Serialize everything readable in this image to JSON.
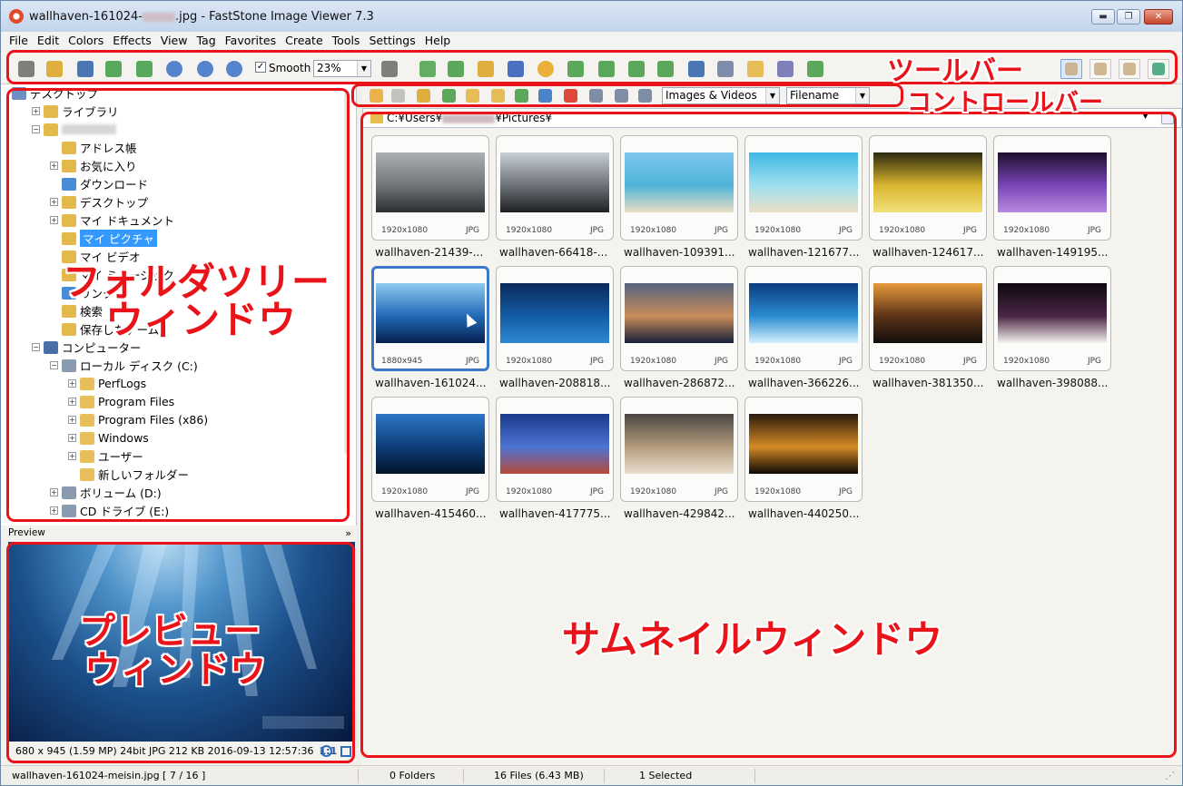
{
  "window": {
    "title_prefix": "wallhaven-161024-",
    "title_suffix": ".jpg  -  FastStone Image Viewer 7.3",
    "min_glyph": "▬",
    "max_glyph": "❐",
    "close_glyph": "✕"
  },
  "menu": [
    "File",
    "Edit",
    "Colors",
    "Effects",
    "View",
    "Tag",
    "Favorites",
    "Create",
    "Tools",
    "Settings",
    "Help"
  ],
  "toolbar": {
    "smooth_label": "Smooth",
    "smooth_checked": "✓",
    "zoom_value": "23%",
    "dropdown_glyph": "▼",
    "icons": [
      "camera-icon",
      "open-folder-icon",
      "save-icon",
      "previous-icon",
      "next-icon",
      "zoom-in-icon",
      "zoom-out-icon",
      "actual-size-icon",
      "hand-tool-icon",
      "slideshow-icon",
      "resize-icon",
      "crop-icon",
      "color-adjust-icon",
      "brightness-icon",
      "stamp-icon",
      "rotate-left-icon",
      "rotate-right-icon",
      "compare-icon",
      "screen-capture-icon",
      "scanner-icon",
      "email-icon",
      "print-icon",
      "batch-icon"
    ],
    "view_icons": [
      "thumbnails-view-icon",
      "preview-view-icon",
      "browser-view-icon",
      "fullscreen-icon"
    ]
  },
  "control_bar": {
    "icons": [
      "back-arrow-icon",
      "forward-arrow-icon",
      "up-folder-icon",
      "refresh-icon",
      "favorites-icon",
      "new-folder-icon",
      "copy-to-icon",
      "move-to-icon",
      "delete-icon",
      "thumbnail-size-icon",
      "details-view-icon",
      "list-view-icon"
    ],
    "filter": "Images & Videos",
    "sort": "Filename"
  },
  "path": {
    "prefix": "C:¥Users¥",
    "suffix": "¥Pictures¥"
  },
  "tree": [
    {
      "label": "デスクトップ",
      "indent": 0,
      "expander": "",
      "icon": "desktop-icon",
      "color": "#6d8fc4"
    },
    {
      "label": "ライブラリ",
      "indent": 1,
      "expander": "+",
      "icon": "library-icon",
      "color": "#e2b94a"
    },
    {
      "label": "",
      "indent": 1,
      "expander": "−",
      "icon": "user-folder-icon",
      "color": "#e2b94a"
    },
    {
      "label": "アドレス帳",
      "indent": 2,
      "expander": "",
      "icon": "contacts-icon",
      "color": "#e2b94a"
    },
    {
      "label": "お気に入り",
      "indent": 2,
      "expander": "+",
      "icon": "favorites-folder-icon",
      "color": "#e2b94a"
    },
    {
      "label": "ダウンロード",
      "indent": 2,
      "expander": "",
      "icon": "downloads-icon",
      "color": "#4a8bd8"
    },
    {
      "label": "デスクトップ",
      "indent": 2,
      "expander": "+",
      "icon": "desktop-folder-icon",
      "color": "#e2b94a"
    },
    {
      "label": "マイ ドキュメント",
      "indent": 2,
      "expander": "+",
      "icon": "documents-icon",
      "color": "#e2b94a"
    },
    {
      "label": "マイ ピクチャ",
      "indent": 2,
      "expander": "",
      "icon": "pictures-icon",
      "color": "#e2b94a",
      "selected": true
    },
    {
      "label": "マイ ビデオ",
      "indent": 2,
      "expander": "",
      "icon": "videos-icon",
      "color": "#e2b94a"
    },
    {
      "label": "マイ ミュージック",
      "indent": 2,
      "expander": "",
      "icon": "music-icon",
      "color": "#e2b94a"
    },
    {
      "label": "リンク",
      "indent": 2,
      "expander": "",
      "icon": "links-icon",
      "color": "#4a8bd8"
    },
    {
      "label": "検索",
      "indent": 2,
      "expander": "",
      "icon": "search-folder-icon",
      "color": "#e2b94a"
    },
    {
      "label": "保存したゲーム",
      "indent": 2,
      "expander": "",
      "icon": "saved-games-icon",
      "color": "#e2b94a"
    },
    {
      "label": "コンピューター",
      "indent": 1,
      "expander": "−",
      "icon": "computer-icon",
      "color": "#4a6fa8"
    },
    {
      "label": "ローカル ディスク (C:)",
      "indent": 2,
      "expander": "−",
      "icon": "drive-c-icon",
      "color": "#8a9bb0"
    },
    {
      "label": "PerfLogs",
      "indent": 3,
      "expander": "+",
      "icon": "folder-icon",
      "color": "#e7c05c"
    },
    {
      "label": "Program Files",
      "indent": 3,
      "expander": "+",
      "icon": "folder-icon",
      "color": "#e7c05c"
    },
    {
      "label": "Program Files (x86)",
      "indent": 3,
      "expander": "+",
      "icon": "folder-icon",
      "color": "#e7c05c"
    },
    {
      "label": "Windows",
      "indent": 3,
      "expander": "+",
      "icon": "folder-icon",
      "color": "#e7c05c"
    },
    {
      "label": "ユーザー",
      "indent": 3,
      "expander": "+",
      "icon": "folder-icon",
      "color": "#e7c05c"
    },
    {
      "label": "新しいフォルダー",
      "indent": 3,
      "expander": "",
      "icon": "folder-icon",
      "color": "#e7c05c"
    },
    {
      "label": "ボリューム (D:)",
      "indent": 2,
      "expander": "+",
      "icon": "drive-d-icon",
      "color": "#8a9bb0"
    },
    {
      "label": "CD ドライブ (E:)",
      "indent": 2,
      "expander": "+",
      "icon": "cd-drive-icon",
      "color": "#8a9bb0"
    }
  ],
  "preview": {
    "header": "Preview",
    "collapse_glyph": "»",
    "info": "680 x 945 (1.59 MP)  24bit  JPG   212 KB   2016-09-13 12:57:36",
    "ratio": "1:1"
  },
  "thumbnails": [
    {
      "name": "wallhaven-21439-...",
      "res": "1920x1080",
      "fmt": "JPG",
      "colors": [
        "#aab0b4",
        "#70757a",
        "#2b2e30"
      ]
    },
    {
      "name": "wallhaven-66418-...",
      "res": "1920x1080",
      "fmt": "JPG",
      "colors": [
        "#c9cfd6",
        "#6d7278",
        "#1e2024"
      ]
    },
    {
      "name": "wallhaven-109391...",
      "res": "1920x1080",
      "fmt": "JPG",
      "colors": [
        "#7ec7ef",
        "#4fb4d8",
        "#e9dfc4"
      ]
    },
    {
      "name": "wallhaven-121677...",
      "res": "1920x1080",
      "fmt": "JPG",
      "colors": [
        "#3eb7e3",
        "#9fe0ef",
        "#ecdfc7"
      ]
    },
    {
      "name": "wallhaven-124617...",
      "res": "1920x1080",
      "fmt": "JPG",
      "colors": [
        "#2c2a10",
        "#d9b52f",
        "#f1e07a"
      ]
    },
    {
      "name": "wallhaven-149195...",
      "res": "1920x1080",
      "fmt": "JPG",
      "colors": [
        "#1c0f2c",
        "#7a45b6",
        "#b88ae0"
      ]
    },
    {
      "name": "wallhaven-161024...",
      "res": "1880x945",
      "fmt": "JPG",
      "colors": [
        "#8ccaf0",
        "#2169b6",
        "#062050"
      ],
      "selected": true
    },
    {
      "name": "wallhaven-208818...",
      "res": "1920x1080",
      "fmt": "JPG",
      "colors": [
        "#0a2a5a",
        "#145ca6",
        "#2d88d0"
      ]
    },
    {
      "name": "wallhaven-286872...",
      "res": "1920x1080",
      "fmt": "JPG",
      "colors": [
        "#54627e",
        "#c98c59",
        "#16203a"
      ]
    },
    {
      "name": "wallhaven-366226...",
      "res": "1920x1080",
      "fmt": "JPG",
      "colors": [
        "#0b3c80",
        "#2a8bd0",
        "#d4f0ff"
      ]
    },
    {
      "name": "wallhaven-381350...",
      "res": "1920x1080",
      "fmt": "JPG",
      "colors": [
        "#e79a3c",
        "#5c3317",
        "#120e0c"
      ]
    },
    {
      "name": "wallhaven-398088...",
      "res": "1920x1080",
      "fmt": "JPG",
      "colors": [
        "#0e0810",
        "#4a2644",
        "#f4f1ee"
      ]
    },
    {
      "name": "wallhaven-415460...",
      "res": "1920x1080",
      "fmt": "JPG",
      "colors": [
        "#2e78c8",
        "#0d3c78",
        "#03142c"
      ]
    },
    {
      "name": "wallhaven-417775...",
      "res": "1920x1080",
      "fmt": "JPG",
      "colors": [
        "#1b3a8a",
        "#4c74d4",
        "#b7493a"
      ]
    },
    {
      "name": "wallhaven-429842...",
      "res": "1920x1080",
      "fmt": "JPG",
      "colors": [
        "#4a4742",
        "#b39b7d",
        "#e9dfcf"
      ]
    },
    {
      "name": "wallhaven-440250...",
      "res": "1920x1080",
      "fmt": "JPG",
      "colors": [
        "#2a1a0c",
        "#d58b25",
        "#0c0804"
      ]
    }
  ],
  "status": {
    "file": "wallhaven-161024-meisin.jpg [ 7 / 16 ]",
    "folders": "0 Folders",
    "files": "16 Files (6.43 MB)",
    "selected": "1 Selected"
  },
  "annotations": {
    "toolbar": "ツールバー",
    "control_bar": "コントロールバー",
    "folder_tree_1": "フォルダツリー",
    "folder_tree_2": "ウィンドウ",
    "preview_1": "プレビュー",
    "preview_2": "ウィンドウ",
    "thumbnail": "サムネイルウィンドウ",
    "color": "#e8141a"
  }
}
